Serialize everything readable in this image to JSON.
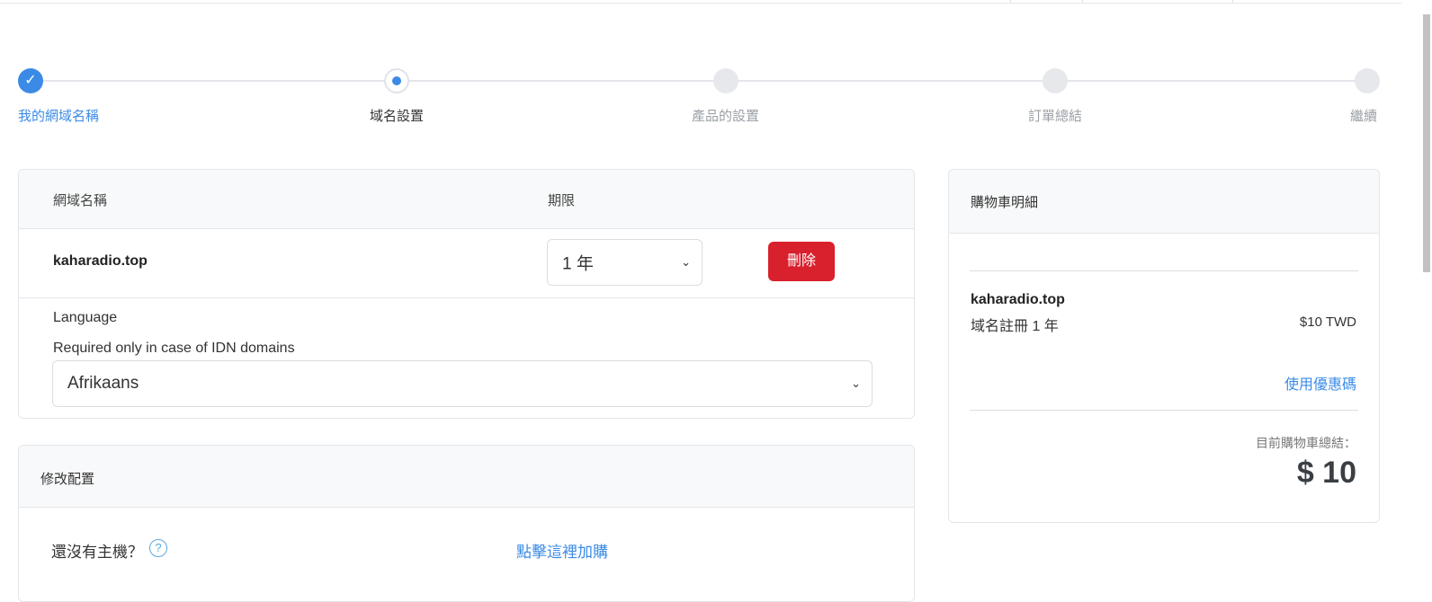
{
  "steps": [
    {
      "label": "我的網域名稱",
      "state": "done"
    },
    {
      "label": "域名設置",
      "state": "current"
    },
    {
      "label": "產品的設置",
      "state": "todo"
    },
    {
      "label": "訂單總結",
      "state": "todo"
    },
    {
      "label": "繼續",
      "state": "todo"
    }
  ],
  "step_check": "✓",
  "cart": {
    "headers": {
      "domain": "網域名稱",
      "period": "期限"
    },
    "domain_name": "kaharadio.top",
    "period_value": "1 年",
    "delete_label": "刪除",
    "language_label": "Language",
    "language_hint": "Required only in case of IDN domains",
    "language_value": "Afrikaans"
  },
  "config": {
    "title": "修改配置",
    "no_host_text": "還沒有主機？",
    "help_symbol": "?",
    "buy_link": "點擊這裡加購"
  },
  "summary": {
    "title": "購物車明細",
    "domain_name": "kaharadio.top",
    "item_desc": "域名註冊 1 年",
    "item_price": "$10 TWD",
    "promo_link": "使用優惠碼",
    "total_label": "目前購物車總結：",
    "total_amount": "$ 10"
  },
  "colors": {
    "accent": "#3b8be6",
    "danger": "#d9202d",
    "inactive_step": "#e6e8ec"
  }
}
